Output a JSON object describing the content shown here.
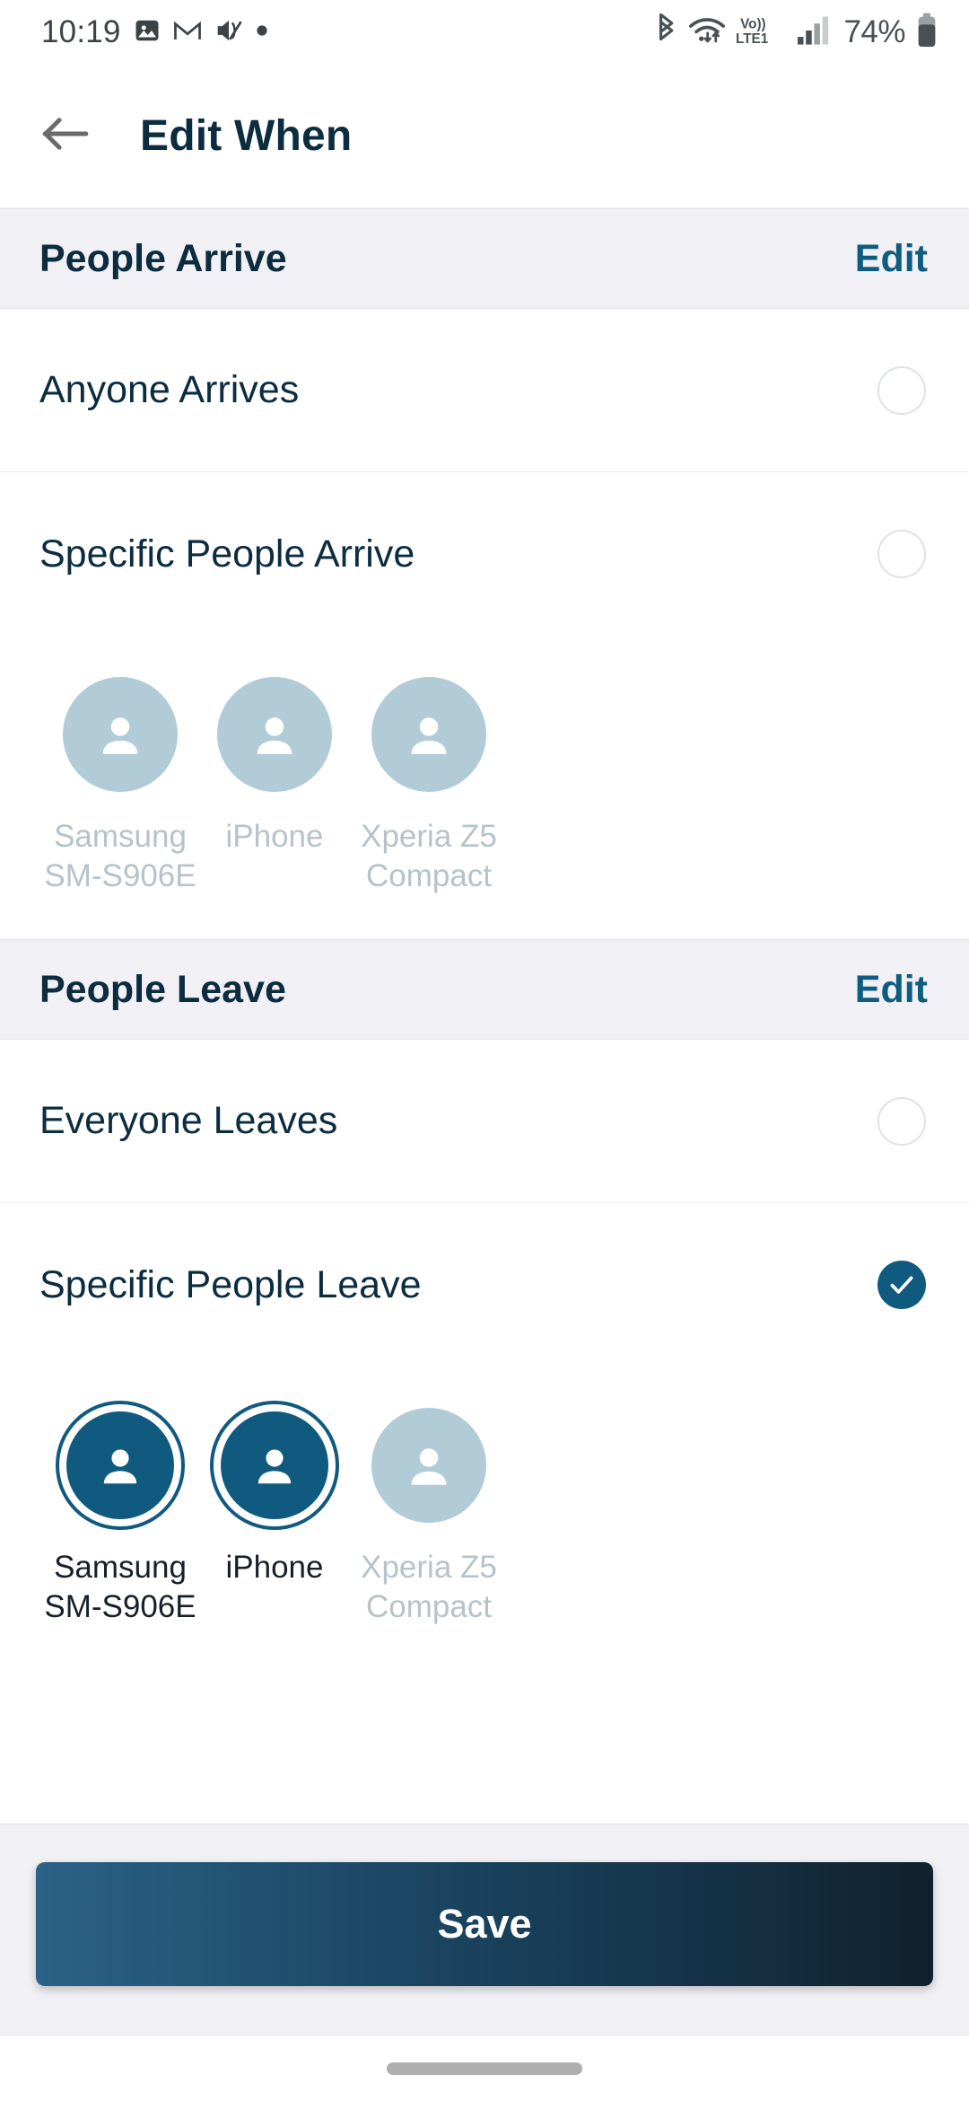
{
  "status_bar": {
    "time": "10:19",
    "left_icons": [
      "photos-icon",
      "gmail-icon",
      "mute-icon",
      "dot-icon"
    ],
    "right_icons": [
      "bluetooth-icon",
      "wifi-icon",
      "volte-icon",
      "signal-icon",
      "battery-icon"
    ],
    "network_label": "Vo))",
    "network_sub": "LTE1",
    "battery": "74%"
  },
  "app_bar": {
    "back_icon": "arrow-left-icon",
    "title": "Edit When"
  },
  "colors": {
    "accent": "#105a80",
    "link": "#0e5c80",
    "title": "#0c2c40",
    "section_bg": "#f0f0f5",
    "avatar_idle": "#b1cbd7",
    "disabled_text": "#b6c3ca"
  },
  "sections": [
    {
      "title": "People Arrive",
      "edit_label": "Edit",
      "options": [
        {
          "label": "Anyone Arrives",
          "checked": false
        },
        {
          "label": "Specific People Arrive",
          "checked": false
        }
      ],
      "people": [
        {
          "name": "Samsung SM-S906E",
          "selected": false
        },
        {
          "name": "iPhone",
          "selected": false
        },
        {
          "name": "Xperia Z5 Compact",
          "selected": false
        }
      ]
    },
    {
      "title": "People Leave",
      "edit_label": "Edit",
      "options": [
        {
          "label": "Everyone Leaves",
          "checked": false
        },
        {
          "label": "Specific People Leave",
          "checked": true
        }
      ],
      "people": [
        {
          "name": "Samsung SM-S906E",
          "selected": true
        },
        {
          "name": "iPhone",
          "selected": true
        },
        {
          "name": "Xperia Z5 Compact",
          "selected": false
        }
      ]
    }
  ],
  "footer": {
    "save_label": "Save"
  }
}
